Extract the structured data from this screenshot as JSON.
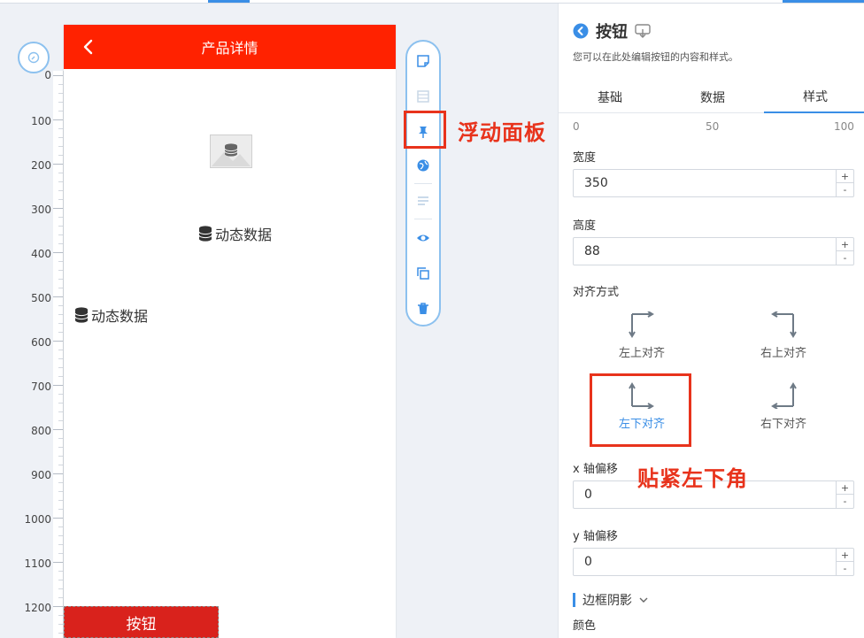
{
  "phone": {
    "title": "产品详情",
    "dynamic_label_1": "动态数据",
    "dynamic_label_2": "动态数据",
    "button_label": "按钮"
  },
  "ruler": {
    "ticks": [
      "0",
      "100",
      "200",
      "300",
      "400",
      "500",
      "600",
      "700",
      "800",
      "900",
      "1000",
      "1100",
      "1200"
    ]
  },
  "toolbar": {
    "icons": [
      "note-icon",
      "layout-icon",
      "pin-icon",
      "globe-icon",
      "lines-icon",
      "eye-icon",
      "copy-icon",
      "trash-icon"
    ]
  },
  "annotations": {
    "float_panel": "浮动面板",
    "corner": "贴紧左下角"
  },
  "panel": {
    "title": "按钮",
    "description": "您可以在此处编辑按钮的内容和样式。",
    "tabs": [
      {
        "label": "基础"
      },
      {
        "label": "数据"
      },
      {
        "label": "样式"
      }
    ],
    "scale": {
      "min": "0",
      "mid": "50",
      "max": "100"
    },
    "width": {
      "label": "宽度",
      "value": "350"
    },
    "height": {
      "label": "高度",
      "value": "88"
    },
    "align": {
      "label": "对齐方式",
      "options": [
        {
          "label": "左上对齐"
        },
        {
          "label": "右上对齐"
        },
        {
          "label": "左下对齐"
        },
        {
          "label": "右下对齐"
        }
      ],
      "selected": "左下对齐"
    },
    "offset_x": {
      "label": "x 轴偏移",
      "value": "0"
    },
    "offset_y": {
      "label": "y 轴偏移",
      "value": "0"
    },
    "shadow_section": "边框阴影",
    "color_label": "颜色",
    "stepper_up": "+",
    "stepper_down": "-"
  },
  "colors": {
    "brand_red": "#ff2200",
    "button_red": "#d9221c",
    "accent_blue": "#3a8ee6",
    "annotation_red": "#e8331c"
  }
}
